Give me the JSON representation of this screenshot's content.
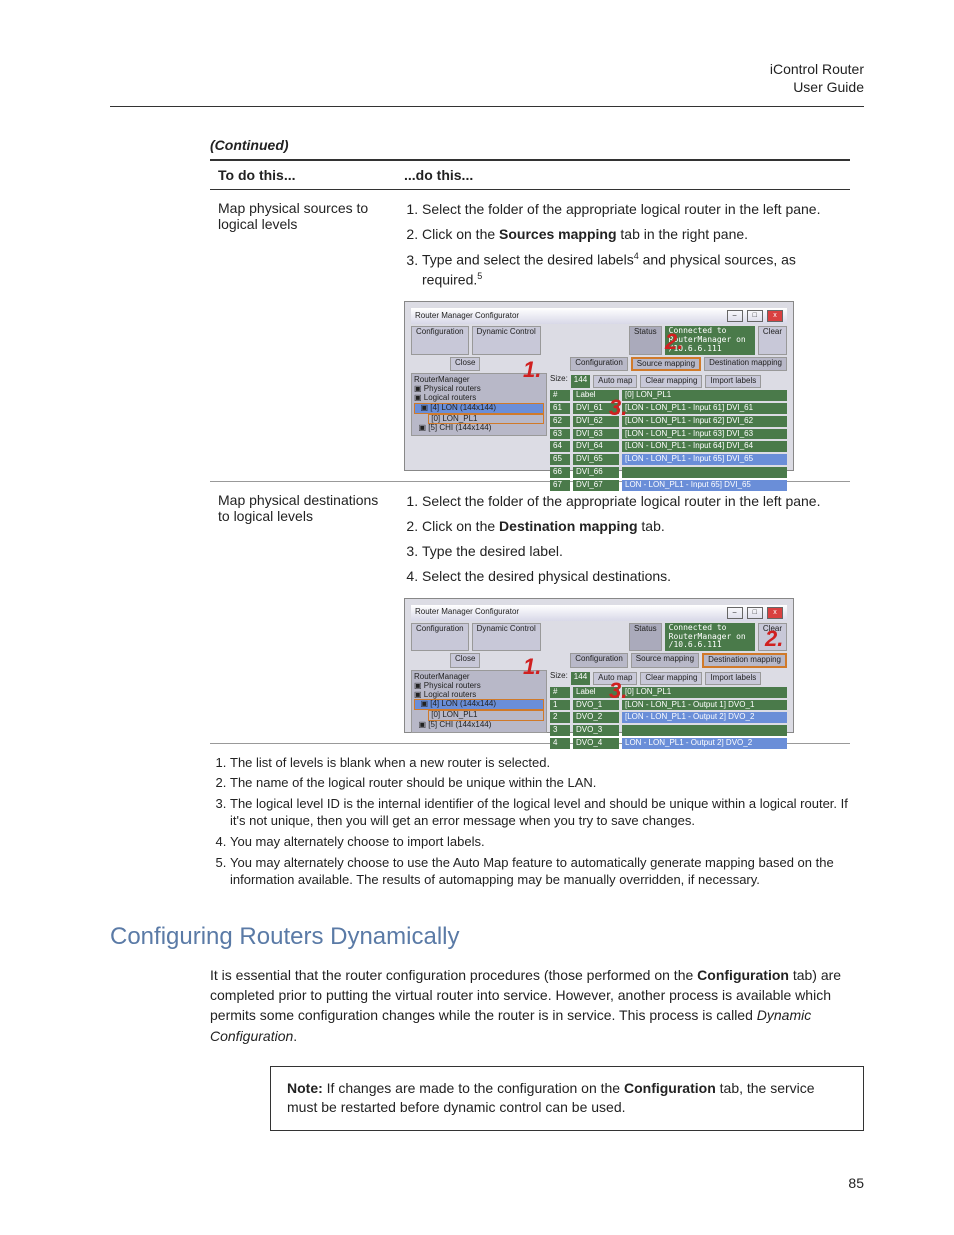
{
  "header": {
    "product": "iControl Router",
    "doc": "User Guide"
  },
  "continued": "(Continued)",
  "table": {
    "col1": "To do this...",
    "col2": "...do this...",
    "row1": {
      "task": "Map physical sources to logical levels",
      "step1a": "Select the folder of the appropriate logical router in the left pane.",
      "step2a": "Click on the ",
      "step2b": "Sources mapping",
      "step2c": " tab in the right pane.",
      "step3a": "Type and select the desired labels",
      "step3sup1": "4",
      "step3b": " and physical sources, as required.",
      "step3sup2": "5"
    },
    "row2": {
      "task": "Map physical destinations to logical levels",
      "step1": "Select the folder of the appropriate logical router in the left pane.",
      "step2a": "Click on the ",
      "step2b": "Destination mapping",
      "step2c": " tab.",
      "step3": "Type the desired label.",
      "step4": "Select the desired physical destinations."
    }
  },
  "shot": {
    "title": "Router Manager Configurator",
    "tabConfig": "Configuration",
    "tabDyn": "Dynamic Control",
    "status": "Status",
    "statusVal": "Connected to RouterManager on /10.6.6.111",
    "clear": "Clear",
    "close": "Close",
    "tabCfg": "Configuration",
    "tabSrc": "Source mapping",
    "tabDst": "Destination mapping",
    "size": "Size:",
    "sizeVal": "144",
    "automap": "Auto map",
    "clearmap": "Clear mapping",
    "import": "Import labels",
    "treeRoot": "RouterManager",
    "treePhys": "Physical routers",
    "treeLog": "Logical routers",
    "treeLON": "[4] LON (144x144)",
    "treeLONpl1": "[0] LON_PL1",
    "treeCHI": "[5] CHI (144x144)",
    "colNum": "#",
    "colLabel": "Label",
    "colOut": "[0] LON_PL1",
    "r61n": "61",
    "r61l": "DVI_61",
    "r61o": "[LON - LON_PL1 - Input 61] DVI_61",
    "r62n": "62",
    "r62l": "DVI_62",
    "r62o": "[LON - LON_PL1 - Input 62] DVI_62",
    "r63n": "63",
    "r63l": "DVI_63",
    "r63o": "[LON - LON_PL1 - Input 63] DVI_63",
    "r64n": "64",
    "r64l": "DVI_64",
    "r64o": "[LON - LON_PL1 - Input 64] DVI_64",
    "r65n": "65",
    "r65l": "DVI_65",
    "r65o": "[LON - LON_PL1 - Input 65] DVI_65",
    "r66n": "66",
    "r66l": "DVI_66",
    "r67n": "67",
    "r67l": "DVI_67",
    "r67o": "LON - LON_PL1 - Input 65] DVI_65",
    "d1n": "1",
    "d1l": "DVO_1",
    "d1o": "[LON - LON_PL1 - Output 1] DVO_1",
    "d2n": "2",
    "d2l": "DVO_2",
    "d2o": "[LON - LON_PL1 - Output 2] DVO_2",
    "d3n": "3",
    "d3l": "DVO_3",
    "d4n": "4",
    "d4l": "DVO_4",
    "d4o": "LON - LON_PL1 - Output 2] DVO_2"
  },
  "callout1": "1.",
  "callout2": "2.",
  "callout3": "3.",
  "footnotes": {
    "f1": "The list of levels is blank when a new router is selected.",
    "f2": "The name of the logical router should be unique within the LAN.",
    "f3": "The logical level ID is the internal identifier of the logical level and should be unique within a logical router. If it's not unique, then you will get an error message when you try to save changes.",
    "f4": "You may alternately choose to import labels.",
    "f5": "You may alternately choose to use the Auto Map feature to automatically generate mapping based on the information available. The results of automapping may be manually overridden, if necessary."
  },
  "section": {
    "title": "Configuring Routers Dynamically",
    "p1a": "It is essential that the router configuration procedures (those performed on the ",
    "p1b": "Configuration",
    "p1c": " tab) are completed prior to putting the virtual router into service. However, another process is available which permits some configuration changes while the router is in service. This process is called ",
    "p1d": "Dynamic Configuration",
    "p1e": "."
  },
  "note": {
    "label": "Note:  ",
    "t1": "If changes are made to the configuration on the ",
    "t2": "Configuration",
    "t3": " tab, the service must be restarted before dynamic control can be used."
  },
  "pagenum": "85"
}
